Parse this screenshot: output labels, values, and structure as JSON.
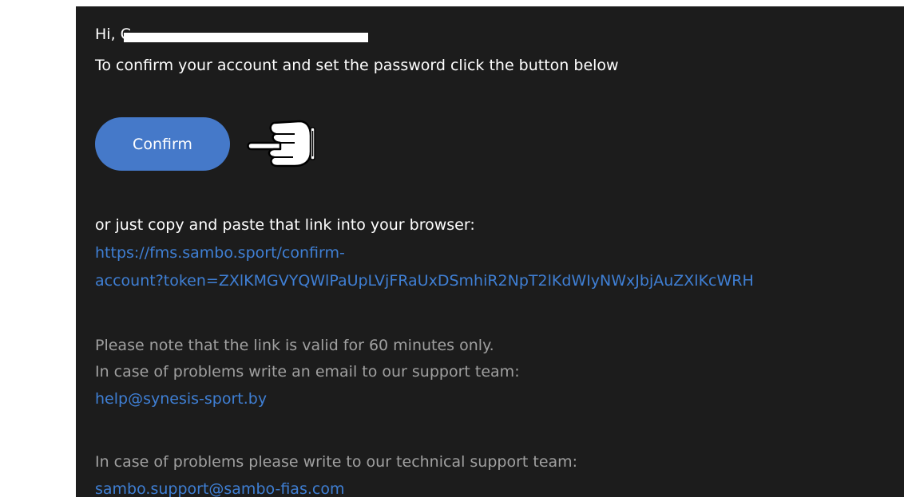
{
  "email": {
    "greeting": "Hi, C",
    "intro": "To confirm your account and set the password click the button below",
    "confirm_button": "Confirm",
    "copy_text": "or just copy and paste that link into your browser:",
    "confirm_link_line1": "https://fms.sambo.sport/confirm-",
    "confirm_link_line2": "account?token=ZXlKMGVYQWlPaUpLVjFRaUxDSmhiR2NpT2lKdWIyNWxJbjAuZXlKcWRH",
    "validity_note": "Please note that the link is valid for 60 minutes only.",
    "problems_note": "In case of problems write an email to our support team:",
    "support_email": "help@synesis-sport.by",
    "tech_note": "In case of problems please write to our technical support team:",
    "tech_email": "sambo.support@sambo-fias.com"
  },
  "icons": {
    "pointer": "pointing-hand-icon"
  },
  "colors": {
    "background": "#1c1c1c",
    "button": "#4579c9",
    "link": "#3f7fd4",
    "muted_text": "#a0a0a0"
  }
}
